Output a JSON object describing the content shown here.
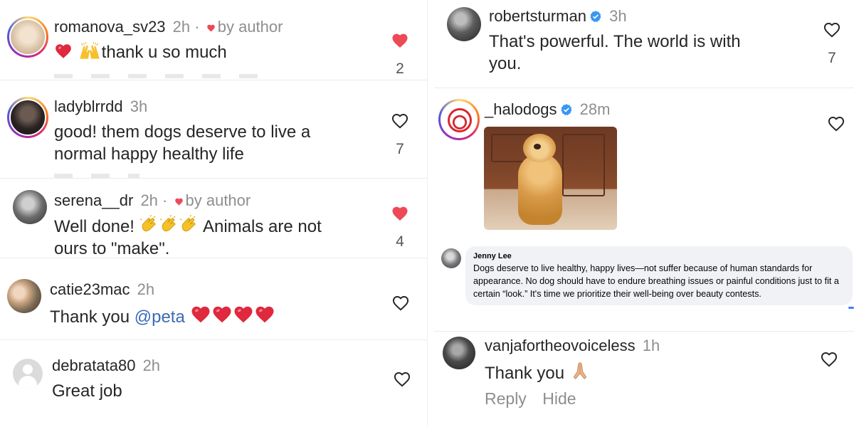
{
  "left_column": {
    "comments": [
      {
        "username": "romanova_sv23",
        "time": "2h",
        "dot": "·",
        "by_author": "by author",
        "text": "thank u so much",
        "likes": "2",
        "liked": true
      },
      {
        "username": "ladyblrrdd",
        "time": "3h",
        "text_line1": "good! them dogs deserve to live a",
        "text_line2": "normal happy healthy life",
        "likes": "7",
        "liked": false
      },
      {
        "username": "serena__dr",
        "time": "2h",
        "dot": "·",
        "by_author": "by author",
        "text_line1_a": "Well done!",
        "text_line1_b": "Animals are not",
        "text_line2": "ours to \"make\".",
        "likes": "4",
        "liked": true
      },
      {
        "username": "catie23mac",
        "time": "2h",
        "text_prefix": "Thank you",
        "mention": "@peta",
        "liked": false
      },
      {
        "username": "debratata80",
        "time": "2h",
        "text": "Great job",
        "liked": false
      }
    ]
  },
  "right_column": {
    "comments": [
      {
        "username": "robertsturman",
        "verified": true,
        "time": "3h",
        "text_line1": "That's powerful. The world is with",
        "text_line2": "you.",
        "likes": "7",
        "liked": false
      },
      {
        "username": "_halodogs",
        "verified": true,
        "time": "28m",
        "has_image": true,
        "liked": false
      },
      {
        "username": "vanjafortheovoiceless",
        "time": "1h",
        "text": "Thank you",
        "reply_label": "Reply",
        "hide_label": "Hide",
        "liked": false
      }
    ],
    "fb_comment": {
      "name": "Jenny Lee",
      "text": "Dogs deserve to live healthy, happy lives—not suffer because of human standards for appearance. No dog should have to endure breathing issues or painful conditions just to fit a certain “look.” It's time we prioritize their well-being over beauty contests."
    }
  },
  "colors": {
    "heart_red": "#ed4956",
    "mention_blue": "#3b6bb6",
    "verified_blue": "#3897f0",
    "muted": "#8e8e8e"
  },
  "icons": [
    "heart-filled-icon",
    "heart-outline-icon",
    "verified-badge-icon",
    "red-heart-emoji",
    "raised-hands-emoji",
    "clapping-hands-emoji",
    "folded-hands-emoji",
    "default-avatar-icon"
  ]
}
